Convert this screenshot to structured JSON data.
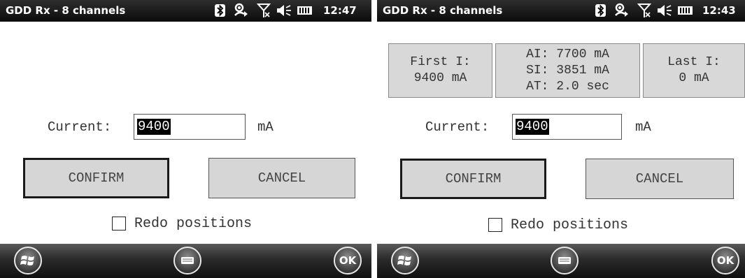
{
  "screens": [
    {
      "status_bar": {
        "title": "GDD Rx - 8 channels",
        "time": "12:47"
      },
      "info_boxes": null,
      "form": {
        "current_label": "Current:",
        "current_value": "9400",
        "unit": "mA",
        "confirm_label": "CONFIRM",
        "cancel_label": "CANCEL",
        "redo_label": "Redo positions",
        "redo_checked": false
      },
      "bottom_bar": {
        "ok_label": "OK"
      }
    },
    {
      "status_bar": {
        "title": "GDD Rx - 8 channels",
        "time": "12:43"
      },
      "info_boxes": {
        "first": {
          "line1": "First I:",
          "line2": "9400 mA"
        },
        "middle": {
          "line1": "AI: 7700 mA",
          "line2": "SI: 3851 mA",
          "line3": "AT: 2.0 sec"
        },
        "last": {
          "line1": "Last I:",
          "line2": "0 mA"
        }
      },
      "form": {
        "current_label": "Current:",
        "current_value": "9400",
        "unit": "mA",
        "confirm_label": "CONFIRM",
        "cancel_label": "CANCEL",
        "redo_label": "Redo positions",
        "redo_checked": false
      },
      "bottom_bar": {
        "ok_label": "OK"
      }
    }
  ],
  "icons": {
    "status": [
      "bluetooth-icon",
      "sync-icon",
      "no-signal-icon",
      "speaker-icon",
      "battery-icon"
    ],
    "bottom": [
      "windows-start-icon",
      "keyboard-icon",
      "ok-icon"
    ]
  },
  "colors": {
    "status_bar": "#111111",
    "button_fill": "#d6d6d6",
    "info_box_fill": "#d8d8d8",
    "selection": "#000000"
  }
}
